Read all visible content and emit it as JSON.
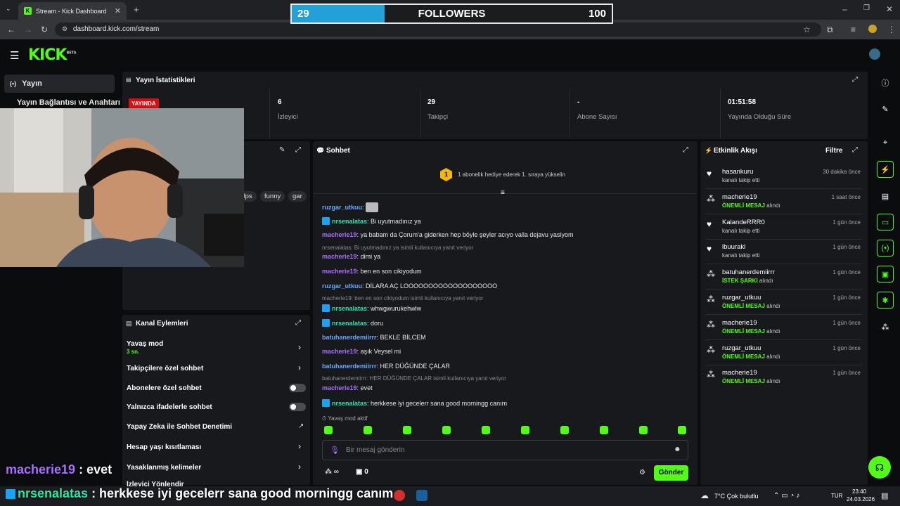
{
  "browser": {
    "tab_title": "Stream - Kick Dashboard",
    "url": "dashboard.kick.com/stream"
  },
  "follower_goal": {
    "current": "29",
    "label": "FOLLOWERS",
    "goal": "100",
    "progress_fraction": 0.29
  },
  "header": {
    "logo": "KICK",
    "logo_sup": "BETA"
  },
  "sidebar": {
    "selected": "Yayın",
    "sub": "Yayın Bağlantısı ve Anahtarı"
  },
  "stats": {
    "title": "Yayın İstatistikleri",
    "live_badge": "YAYINDA",
    "items": [
      {
        "value": "6",
        "label": "İzleyici"
      },
      {
        "value": "29",
        "label": "Takipçi"
      },
      {
        "value": "-",
        "label": "Abone Sayısı"
      },
      {
        "value": "01:51:58",
        "label": "Yayında Olduğu Süre"
      }
    ]
  },
  "tags": [
    "fps",
    "funny",
    "gar"
  ],
  "chat": {
    "title": "Sohbet",
    "goal_badge": "1",
    "goal_text": "1 abonelik hediye ederek 1. sıraya yükselin",
    "messages": [
      {
        "user": "ruzgar_utkuu",
        "text": "",
        "color": "#6aa8ff"
      },
      {
        "user": "nrsenalatas",
        "text": "Bi uyutmadınız ya",
        "color": "#2ee6a6"
      },
      {
        "user": "macherie19",
        "text": "ya babam da Çorum'a giderken hep böyle şeyler acıyo valla dejavu yasiyom",
        "color": "#a970ff"
      },
      {
        "reply": "nrsenalatas: Bi uyutmadınız ya isimli kullanıcıya yanıt veriyor"
      },
      {
        "user": "macherie19",
        "text": "dimi ya",
        "color": "#a970ff"
      },
      {
        "user": "macherie19",
        "text": "ben en son cikiyodum",
        "color": "#a970ff"
      },
      {
        "user": "ruzgar_utkuu",
        "text": "DİLARA AÇ LOOOOOOOOOOOOOOOOOOO",
        "color": "#6aa8ff"
      },
      {
        "reply": "macherie19: ben en son cikiyodum isimli kullanıcıya yanıt veriyor"
      },
      {
        "user": "nrsenalatas",
        "text": "whwgwurukehwlw",
        "color": "#2ee6a6"
      },
      {
        "user": "nrsenalatas",
        "text": "doru",
        "color": "#2ee6a6"
      },
      {
        "user": "batuhanerdemiirrr",
        "text": "BEKLE BİLCEM",
        "color": "#6aa8ff"
      },
      {
        "user": "macherie19",
        "text": "aşık Veysel mi",
        "color": "#a970ff"
      },
      {
        "user": "batuhanerdemiirrr",
        "text": "HER DÜĞÜNDE ÇALAR",
        "color": "#6aa8ff"
      },
      {
        "reply": "batuhanerdemiirrr: HER DÜĞÜNDE ÇALAR isimli kullanıcıya yanıt veriyor"
      },
      {
        "user": "macherie19",
        "text": "evet",
        "color": "#a970ff"
      },
      {
        "user": "nrsenalatas",
        "text": "herkkese iyi gecelerr sana good morningg canım",
        "color": "#2ee6a6"
      }
    ],
    "slow_mode": "Yavaş mod aktif",
    "input_placeholder": "Bir mesaj gönderin",
    "points": "∞",
    "gifts": "0",
    "send_label": "Gönder"
  },
  "channel_actions": {
    "title": "Kanal Eylemleri",
    "slow_mode": {
      "label": "Yavaş mod",
      "value": "3 sn."
    },
    "items": [
      "Takipçilere özel sohbet",
      "Abonelere özel sohbet",
      "Yalnızca ifadelerle sohbet",
      "Yapay Zeka ile Sohbet Denetimi",
      "Hesap yaşı kısıtlaması",
      "Yasaklanmış kelimeler",
      "İzleyici Yönlendir"
    ]
  },
  "activity": {
    "title": "Etkinlik Akışı",
    "filter": "Filtre",
    "events": [
      {
        "user": "hasankuru",
        "sub": "kanalı takip etti",
        "time": "30 dakika önce",
        "icon": "heart-icon"
      },
      {
        "user": "macherie19",
        "sub_b": "ÖNEMLİ MESAJ",
        "sub": "alındı",
        "time": "1 saat önce",
        "icon": "kicks-icon"
      },
      {
        "user": "KalandeRRR0",
        "sub": "kanalı takip etti",
        "time": "1 gün önce",
        "icon": "heart-icon"
      },
      {
        "user": "lbuurakl",
        "sub": "kanalı takip etti",
        "time": "1 gün önce",
        "icon": "heart-icon"
      },
      {
        "user": "batuhanerdemiirrr",
        "sub_b": "İSTEK ŞARKI",
        "sub": "alındı",
        "time": "1 gün önce",
        "icon": "kicks-icon"
      },
      {
        "user": "ruzgar_utkuu",
        "sub_b": "ÖNEMLİ MESAJ",
        "sub": "alındı",
        "time": "1 gün önce",
        "icon": "kicks-icon"
      },
      {
        "user": "macherie19",
        "sub_b": "ÖNEMLİ MESAJ",
        "sub": "alındı",
        "time": "1 gün önce",
        "icon": "kicks-icon"
      },
      {
        "user": "ruzgar_utkuu",
        "sub_b": "ÖNEMLİ MESAJ",
        "sub": "alındı",
        "time": "1 gün önce",
        "icon": "kicks-icon"
      },
      {
        "user": "macherie19",
        "sub_b": "ÖNEMLİ MESAJ",
        "sub": "alındı",
        "time": "1 gün önce",
        "icon": "kicks-icon"
      }
    ]
  },
  "overlay": {
    "line1_user": "macherie19",
    "line1_text": " : evet",
    "line2_user": "nrsenalatas",
    "line2_text": " : herkkese iyi gecelerr sana good morningg canım"
  },
  "taskbar": {
    "weather": "7°C  Çok bulutlu",
    "lang": "TUR",
    "time": "23:40",
    "date": "24.03.2026"
  },
  "colors": {
    "kick_green": "#53fc18",
    "panel": "#18191c",
    "bg": "#0b0c0e",
    "live_red": "#d90d0d"
  }
}
